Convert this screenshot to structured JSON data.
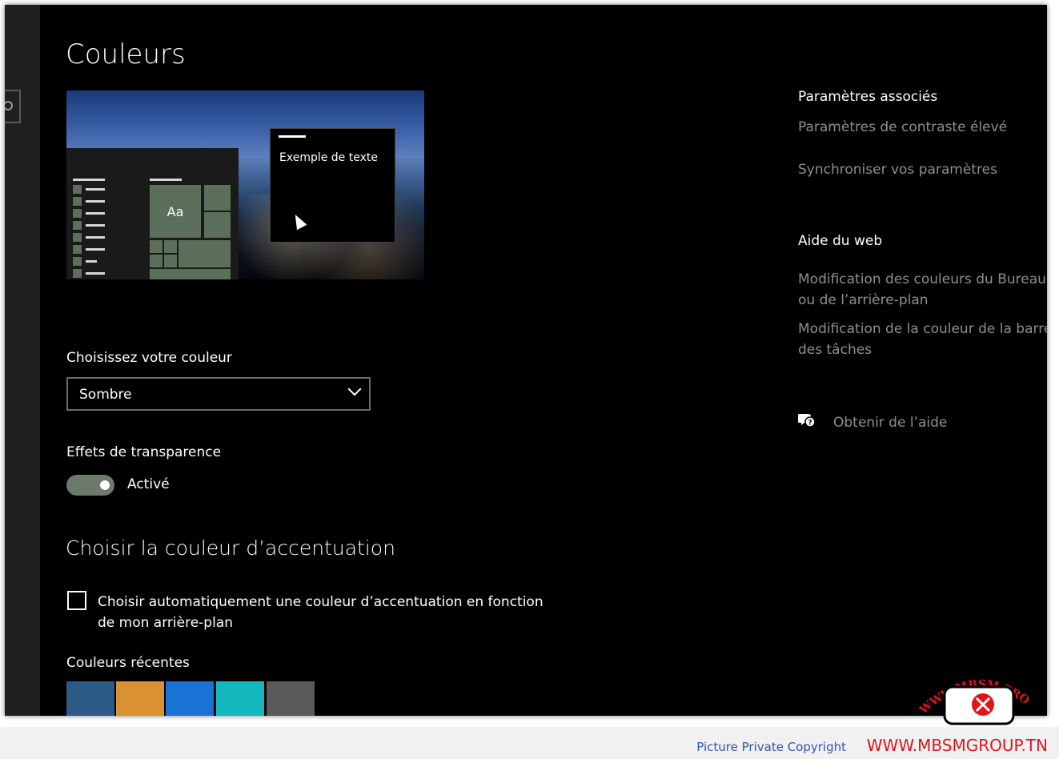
{
  "page": {
    "title": "Couleurs"
  },
  "preview": {
    "sample_text": "Exemple de texte",
    "tile_label": "Aa"
  },
  "choose_color": {
    "label": "Choisissez votre couleur",
    "selected": "Sombre"
  },
  "transparency": {
    "label": "Effets de transparence",
    "state_label": "Activé",
    "on": true
  },
  "accent": {
    "heading": "Choisir la couleur d’accentuation",
    "auto_checkbox_label": "Choisir automatiquement une couleur d’accentuation en fonction de mon arrière-plan",
    "auto_checked": false,
    "recent_label": "Couleurs récentes",
    "recent_colors": [
      "#2c5a86",
      "#d99132",
      "#1a73d4",
      "#12b8bd",
      "#5a5a5a"
    ]
  },
  "related": {
    "heading": "Paramètres associés",
    "links": [
      "Paramètres de contraste élevé",
      "Synchroniser vos paramètres"
    ]
  },
  "web_help": {
    "heading": "Aide du web",
    "links": [
      "Modification des couleurs du Bureau ou de l’arrière-plan",
      "Modification de la couleur de la barre des tâches"
    ]
  },
  "get_help": {
    "label": "Obtenir de l’aide",
    "icon": "help-chat-icon"
  },
  "footer": {
    "copyright": "Picture Private Copyright",
    "site": "WWW.MBSMGROUP.TN"
  },
  "watermark": {
    "text": "WWW.MBSM.PRO"
  }
}
